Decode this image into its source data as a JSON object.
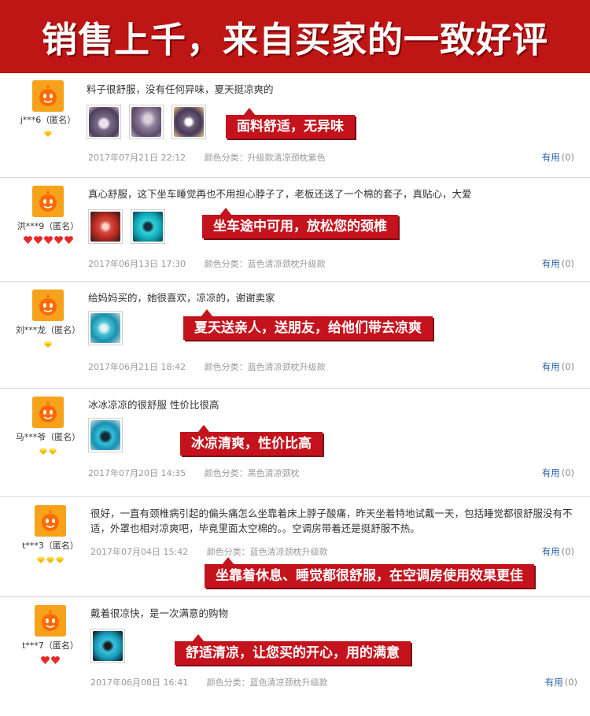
{
  "banner": {
    "title": "销售上千，来自买家的一致好评"
  },
  "reviews": [
    {
      "user": "j***6（匿名）",
      "text": "料子很舒服，没有任何异味，夏天挺凉爽的",
      "tag": "面料舒适，无异味",
      "date": "2017年07月21日 22:12",
      "color": "颜色分类：升级款清凉颈枕紫色",
      "useful": "有用",
      "count": "(0)"
    },
    {
      "user": "洪***9（匿名）",
      "text": "真心舒服，这下坐车睡觉再也不用担心脖子了，老板还送了一个棉的套子，真贴心，大爱",
      "tag": "坐车途中可用，放松您的颈椎",
      "date": "2017年06月13日 17:30",
      "color": "颜色分类：蓝色清凉颈枕升级款",
      "useful": "有用",
      "count": "(0)"
    },
    {
      "user": "刘***龙（匿名）",
      "text": "给妈妈买的，她很喜欢，凉凉的，谢谢卖家",
      "tag": "夏天送亲人，送朋友，给他们带去凉爽",
      "date": "2017年06月21日 18:42",
      "color": "颜色分类：蓝色清凉颈枕升级款",
      "useful": "有用",
      "count": "(0)"
    },
    {
      "user": "马***爷（匿名）",
      "text": "冰冰凉凉的很舒服 性价比很高",
      "tag": "冰凉清爽，性价比高",
      "date": "2017年07月20日 14:35",
      "color": "颜色分类：黑色清凉颈枕",
      "useful": "有用",
      "count": "(0)"
    },
    {
      "user": "t***3（匿名）",
      "text": "很好，一直有颈椎病引起的偏头痛怎么坐靠着床上脖子酸痛，昨天坐着特地试戴一天，包括睡觉都很舒服没有不适，外罩也相对凉爽吧，毕竟里面太空棉的。。空调房带着还是挺舒服不热。",
      "tag": "坐靠着休息、睡觉都很舒服，在空调房使用效果更佳",
      "date": "2017年07月04日 15:42",
      "color": "颜色分类：蓝色清凉颈枕升级款",
      "useful": "有用",
      "count": "(0)"
    },
    {
      "user": "t***7（匿名）",
      "text": "戴着很凉快，是一次满意的购物",
      "tag": "舒适清凉，让您买的开心，用的满意",
      "date": "2017年06月08日 16:41",
      "color": "颜色分类：蓝色清凉颈枕升级款",
      "useful": "有用",
      "count": "(0)"
    }
  ],
  "icons": {
    "avatar": "taobao-doll-avatar-icon",
    "badge_diamond": "yellow-diamond-icon",
    "badge_heart": "red-heart-icon"
  },
  "colors": {
    "banner_bg": "#be1515",
    "tag_bg": "#c4131d",
    "link": "#2e63a8"
  }
}
